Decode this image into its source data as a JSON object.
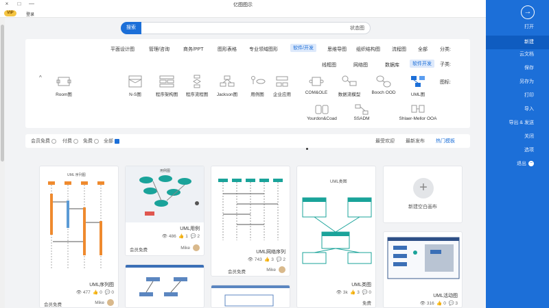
{
  "window": {
    "title": "亿图图示",
    "controls": [
      "×",
      "□",
      "—"
    ]
  },
  "subbar": {
    "vip": "VIP",
    "user": "登录"
  },
  "sidebar": {
    "items": [
      {
        "label": "打开",
        "active": false
      },
      {
        "label": "新建",
        "active": true
      },
      {
        "label": "云文档",
        "active": false
      },
      {
        "label": "保存",
        "active": false
      },
      {
        "label": "另存为",
        "active": false
      },
      {
        "label": "打印",
        "active": false
      },
      {
        "label": "导入",
        "active": false
      },
      {
        "label": "导出 & 发送",
        "active": false
      },
      {
        "label": "关闭",
        "active": false
      },
      {
        "label": "选项",
        "active": false
      }
    ],
    "exit_label": "退出"
  },
  "search": {
    "button": "搜索",
    "value": "状态图"
  },
  "filters": {
    "category_label": "分类:",
    "categories": [
      "全部",
      "流程图",
      "组织结构图",
      "思维导图",
      "软件/开发",
      "专业领域图形",
      "图形表格",
      "商务/PPT",
      "管理/咨询",
      "平面设计图"
    ],
    "active_category": "软件/开发",
    "subcategory_label": "子类:",
    "subcategories": [
      "软件开发",
      "数据库",
      "网络图",
      "线框图"
    ],
    "active_subcategory": "软件开发",
    "type_label": "图标:",
    "types_row1": [
      "UML图",
      "Booch OOD",
      "数据流模型",
      "COM&OLE",
      "企业应用",
      "用例图",
      "Jackson图",
      "程序流程图",
      "程序架构图",
      "N-S图",
      "Room图"
    ],
    "types_row2": [
      "Shlaer-Mellor OOA",
      "SSADM",
      "Yourdon&Coad"
    ]
  },
  "sort": {
    "options": [
      "热门模板",
      "最新发布",
      "最受欢迎"
    ],
    "active": "热门模板",
    "checks": [
      {
        "label": "全部",
        "checked": true
      },
      {
        "label": "免费",
        "checked": false
      },
      {
        "label": "付费",
        "checked": false
      },
      {
        "label": "会员免费",
        "checked": false
      }
    ]
  },
  "new_card": {
    "label": "新建空白画布",
    "plus": "+"
  },
  "cards": [
    {
      "id": "uml-class",
      "title": "UML类图",
      "views": "3k",
      "likes": "3",
      "comments": "0",
      "price": "免费",
      "author": "",
      "heading": "UML类图"
    },
    {
      "id": "uml-activity",
      "title": "UML活动图",
      "views": "316",
      "likes": "0",
      "comments": "3",
      "price": "",
      "author": ""
    },
    {
      "id": "uml-sequence-net",
      "title": "UML网络序列",
      "views": "743",
      "likes": "3",
      "comments": "2",
      "price": "会员免费",
      "author": "Mike"
    },
    {
      "id": "uml-usecase",
      "title": "UML用例",
      "views": "486",
      "likes": "1",
      "comments": "2",
      "price": "会员免费",
      "author": "Mike",
      "heading": "用例图"
    },
    {
      "id": "uml-seq",
      "title": "UML序列图",
      "views": "477",
      "likes": "0",
      "comments": "0",
      "price": "会员免费",
      "author": "Mike",
      "heading": "UML 序列图"
    }
  ]
}
